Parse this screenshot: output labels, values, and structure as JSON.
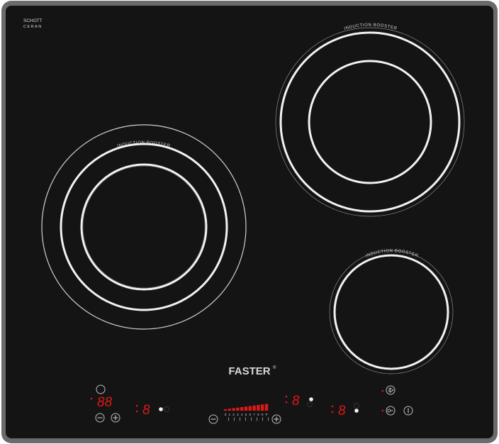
{
  "brand": {
    "glass_maker_line1": "SCHOTT",
    "glass_maker_line2": "CERAN",
    "logo_text": "FASTER",
    "logo_mark": "®"
  },
  "zones": {
    "booster_label": "INDUCTION BOOSTER"
  },
  "controls": {
    "timer_display": "88",
    "zone_display_1": "8",
    "zone_display_2": "8",
    "zone_display_3": "8",
    "slider_scale": [
      "0",
      "1",
      "2",
      "3",
      "4",
      "5",
      "6",
      "7",
      "8",
      "9",
      "P"
    ]
  },
  "colors": {
    "glass": "#141414",
    "frame": "#6b6b6b",
    "ring": "#e8e8e8",
    "led": "#e01818",
    "print": "#d8d8d8"
  }
}
